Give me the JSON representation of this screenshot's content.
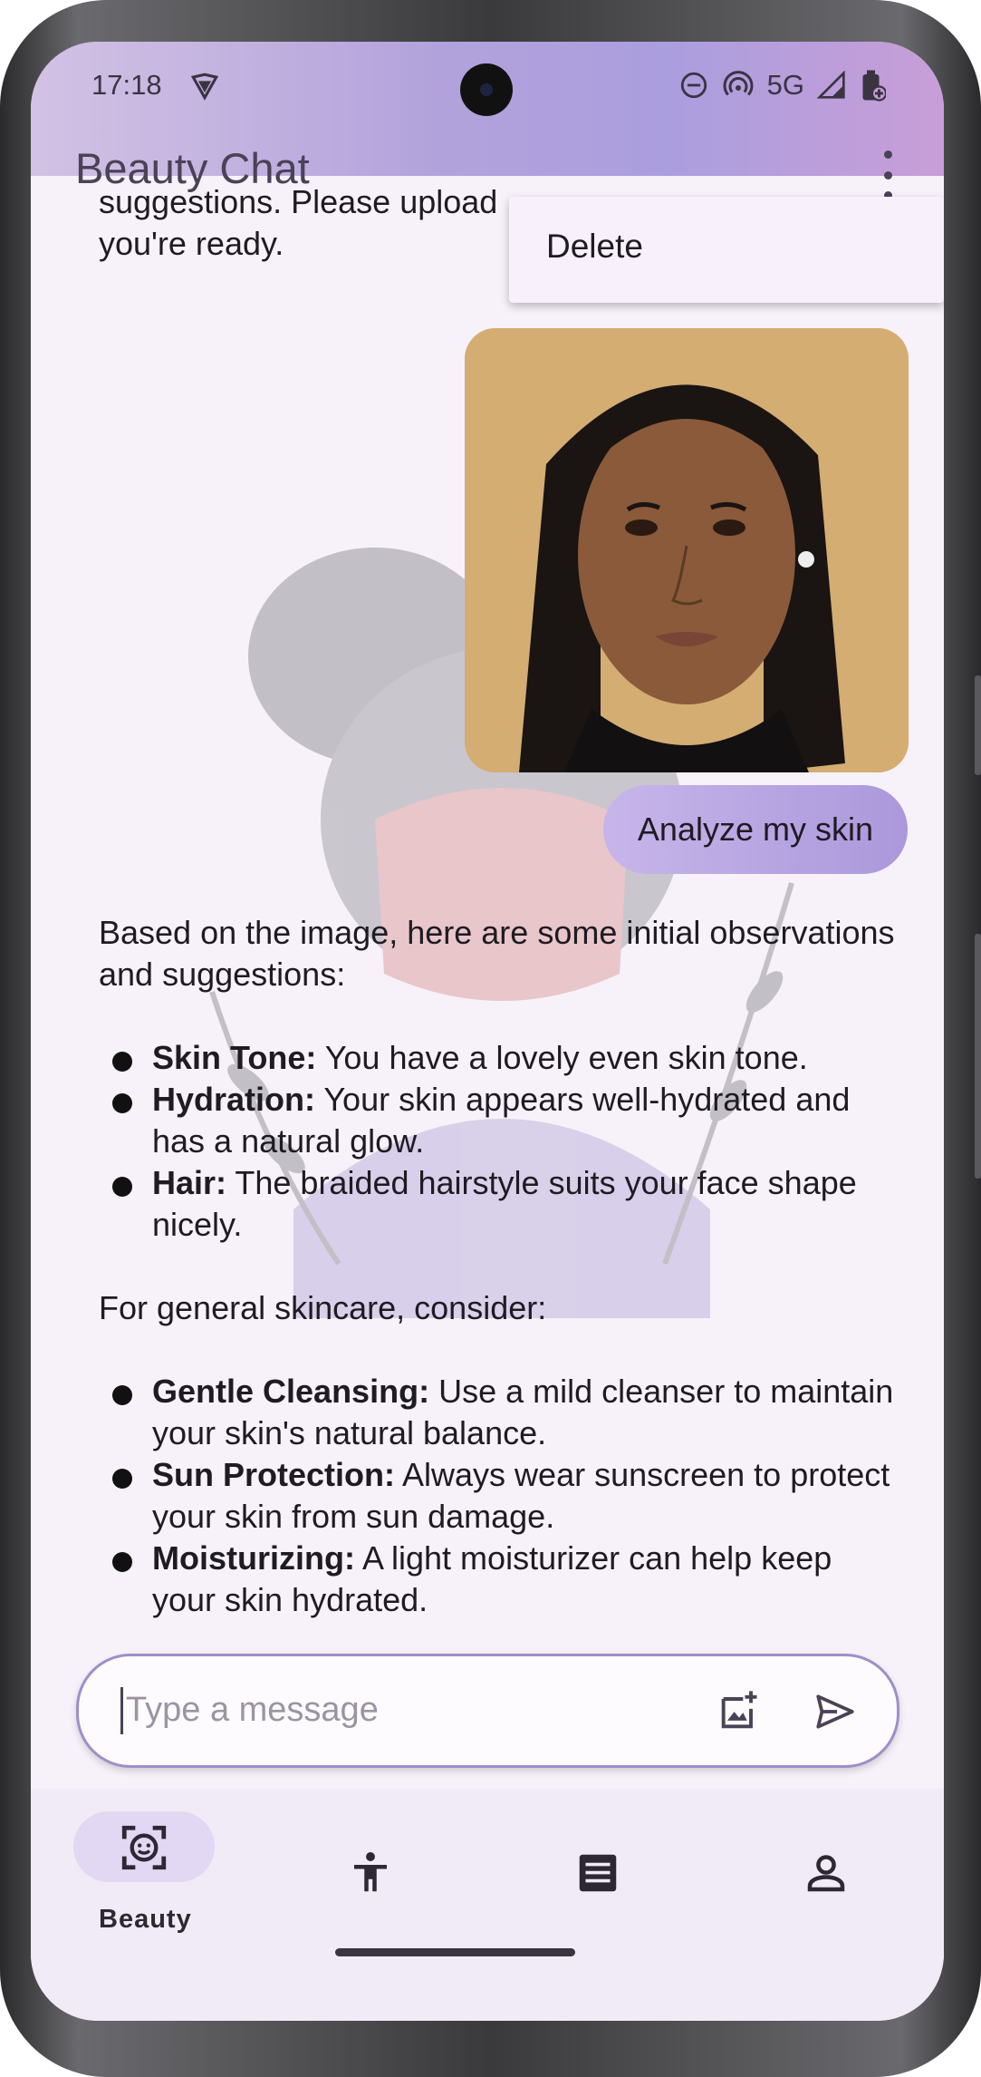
{
  "status_bar": {
    "time": "17:18",
    "network": "5G"
  },
  "app_bar": {
    "title": "Beauty Chat"
  },
  "menu": {
    "items": [
      {
        "label": "Delete"
      }
    ]
  },
  "messages": {
    "partial_top_line1": "suggestions. Please upload",
    "partial_top_line2": "you're ready.",
    "user_text": "Analyze my skin",
    "reply": {
      "intro": "Based on the image, here are some initial observations and suggestions:",
      "list1": [
        {
          "title": "Skin Tone:",
          "text": " You have a lovely even skin tone."
        },
        {
          "title": "Hydration:",
          "text": " Your skin appears well-hydrated and has a natural glow."
        },
        {
          "title": "Hair:",
          "text": " The braided hairstyle suits your face shape nicely."
        }
      ],
      "middle": "For general skincare, consider:",
      "list2": [
        {
          "title": "Gentle Cleansing:",
          "text": " Use a mild cleanser to maintain your skin's natural balance."
        },
        {
          "title": "Sun Protection:",
          "text": " Always wear sunscreen to protect your skin from sun damage."
        },
        {
          "title": "Moisturizing:",
          "text": " A light moisturizer can help keep your skin hydrated."
        }
      ]
    }
  },
  "input": {
    "placeholder": "Type a message",
    "value": ""
  },
  "bottom_nav": {
    "items": [
      {
        "label": "Beauty",
        "icon": "face-scan-icon",
        "selected": true
      },
      {
        "label": "",
        "icon": "accessibility-icon",
        "selected": false
      },
      {
        "label": "",
        "icon": "article-icon",
        "selected": false
      },
      {
        "label": "",
        "icon": "person-icon",
        "selected": false
      }
    ]
  },
  "colors": {
    "accent": "#ab9ede",
    "bubble": "#b9a7e2",
    "background": "#f7f1f9"
  }
}
